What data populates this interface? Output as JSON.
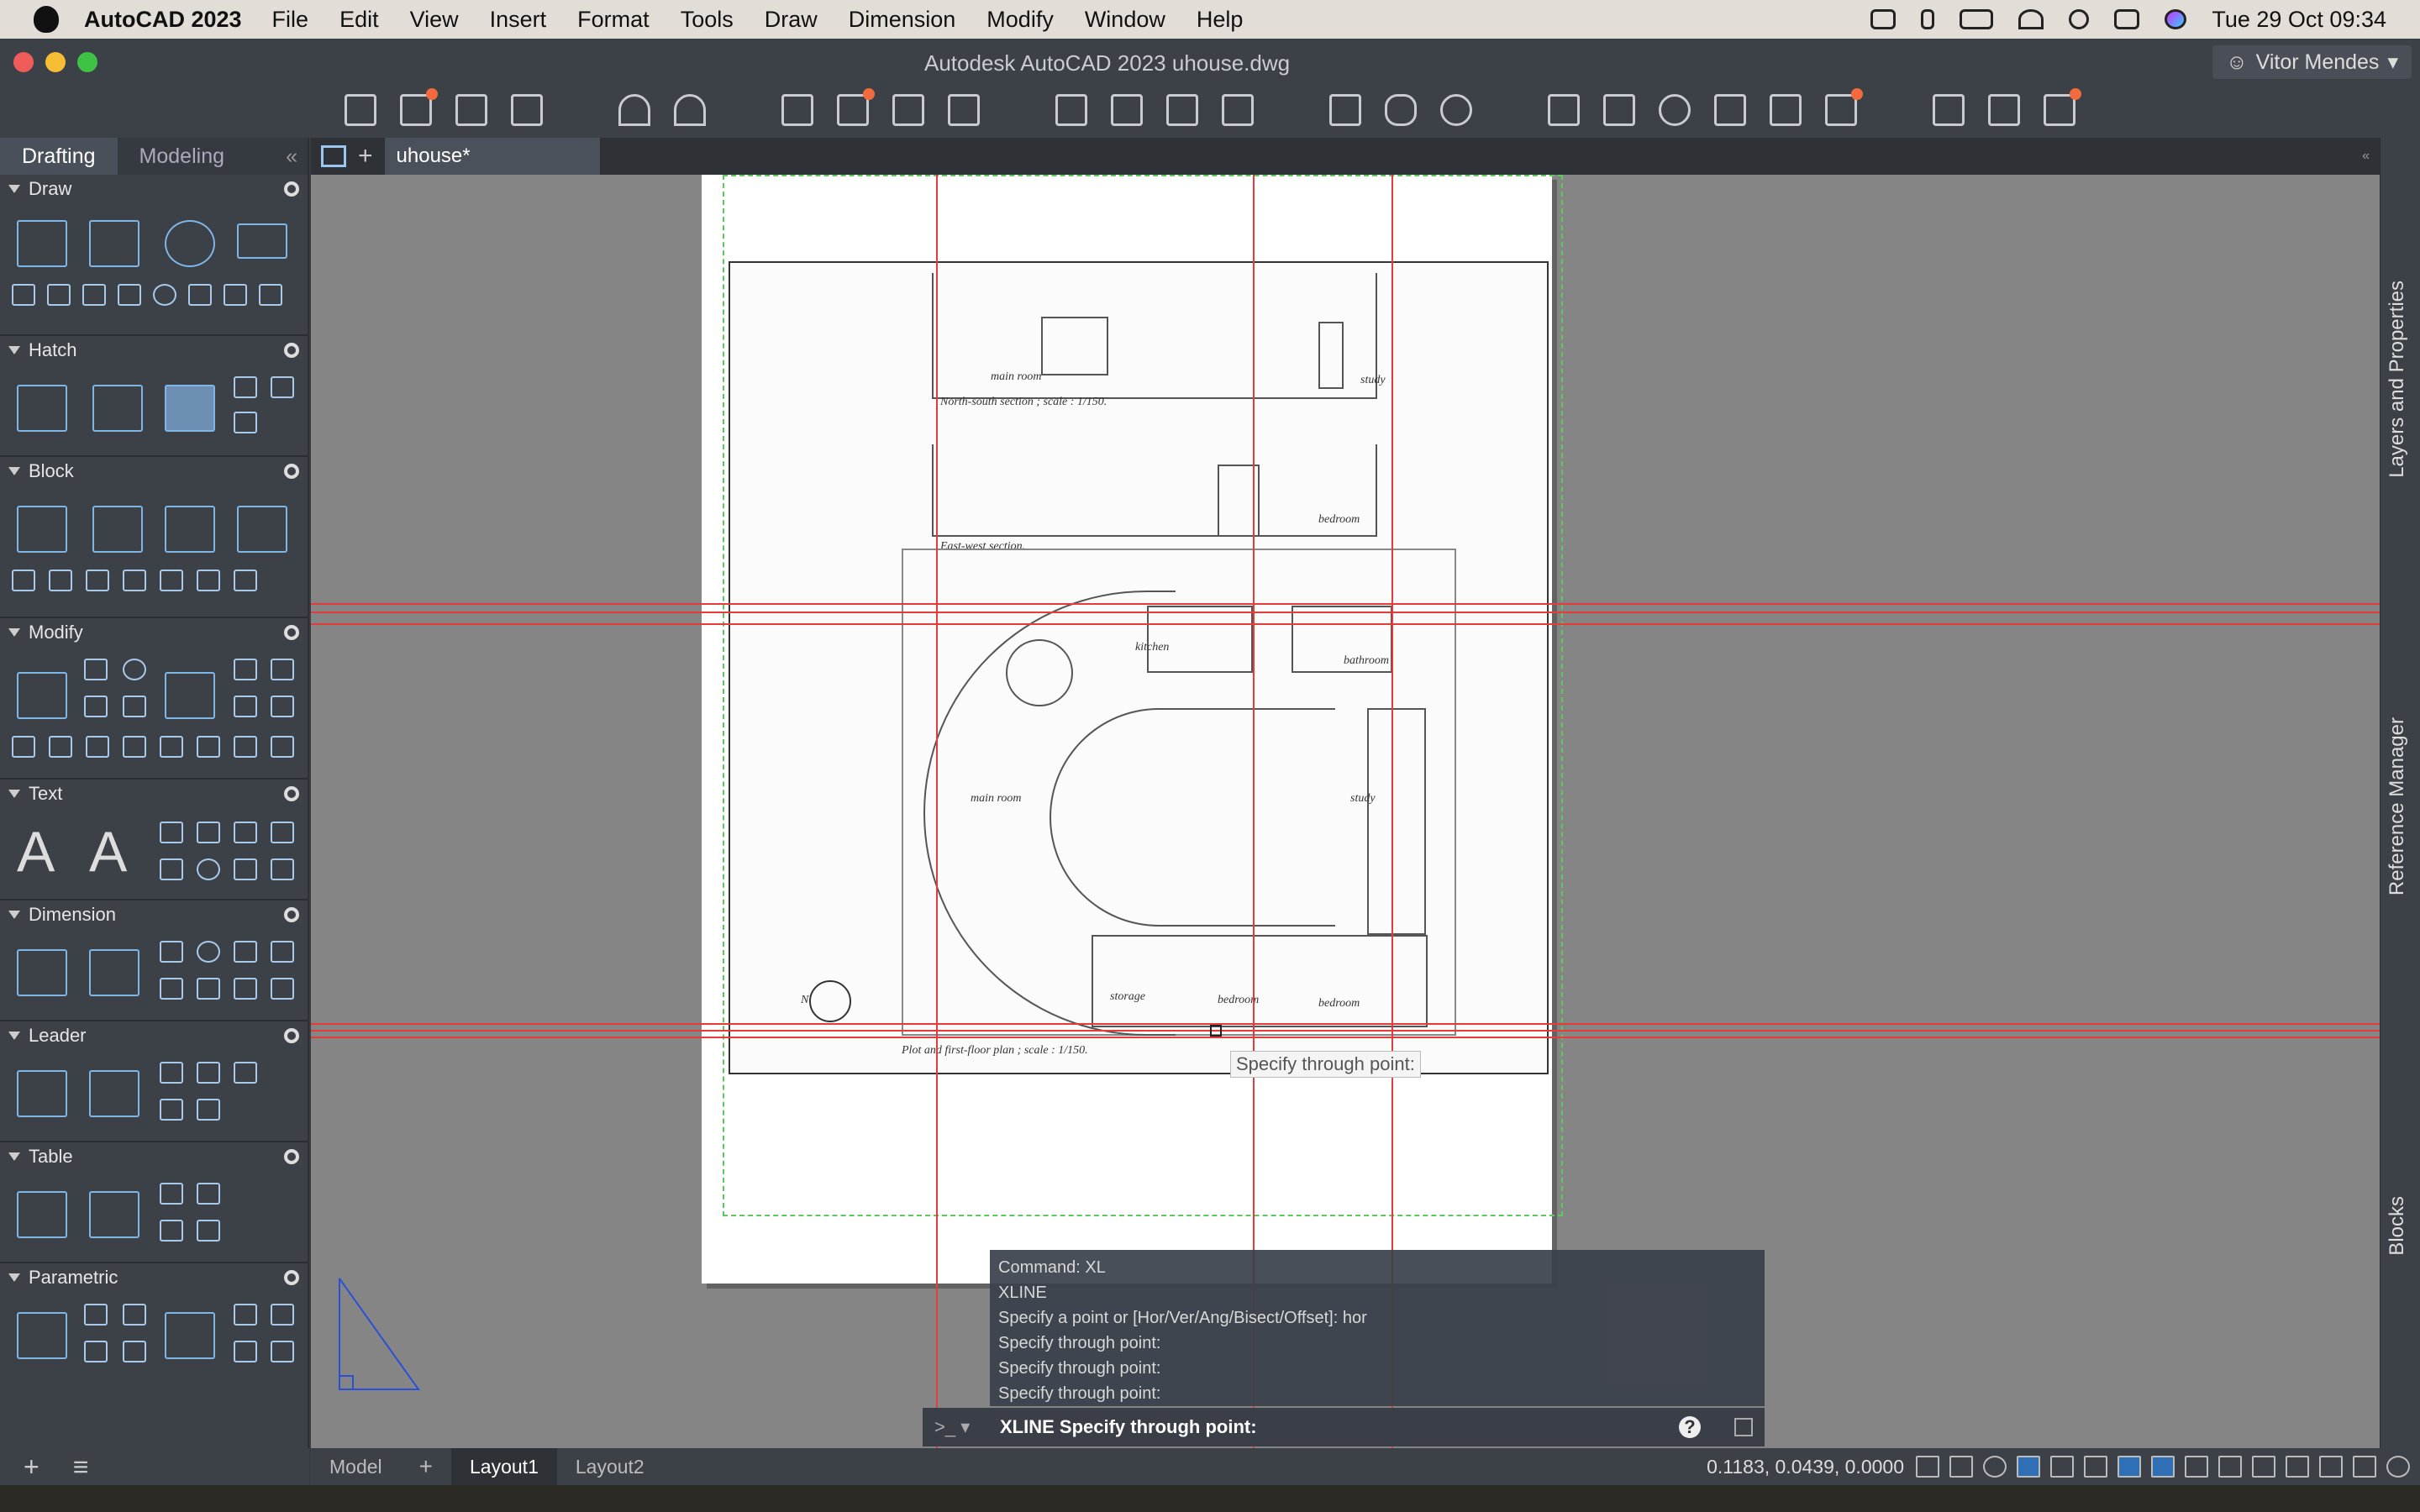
{
  "menubar": {
    "app_name": "AutoCAD 2023",
    "items": [
      "File",
      "Edit",
      "View",
      "Insert",
      "Format",
      "Tools",
      "Draw",
      "Dimension",
      "Modify",
      "Window",
      "Help"
    ],
    "datetime": "Tue 29 Oct  09:34"
  },
  "window": {
    "title": "Autodesk AutoCAD 2023    uhouse.dwg",
    "user": "Vitor Mendes"
  },
  "workspace_tabs": {
    "drafting": "Drafting",
    "modeling": "Modeling"
  },
  "palette_sections": {
    "draw": "Draw",
    "hatch": "Hatch",
    "block": "Block",
    "modify": "Modify",
    "text": "Text",
    "dimension": "Dimension",
    "leader": "Leader",
    "table": "Table",
    "parametric": "Parametric"
  },
  "document_tab": "uhouse*",
  "drawing_labels": {
    "ns_section": "North-south section ; scale :   1/150.",
    "ew_section": "East-west section.",
    "plan": "Plot and first-floor plan ; scale :   1/150.",
    "main_room_1": "main room",
    "study_1": "study",
    "bedroom_1": "bedroom",
    "kitchen": "kitchen",
    "bathroom": "bathroom",
    "main_room_2": "main room",
    "study_2": "study",
    "storage": "storage",
    "bedroom_2": "bedroom",
    "bedroom_3": "bedroom",
    "north": "N"
  },
  "tooltip": "Specify through point:",
  "command_history": [
    "Command: XL",
    "XLINE",
    "Specify a point or [Hor/Ver/Ang/Bisect/Offset]: hor",
    "Specify through point:",
    "Specify through point:",
    "Specify through point:"
  ],
  "command_prompt": {
    "symbol": ">_ ▾",
    "text": "XLINE Specify through point:",
    "help": "?"
  },
  "right_dock": {
    "layers": "Layers and Properties",
    "refs": "Reference Manager",
    "blocks": "Blocks"
  },
  "statusbar": {
    "model": "Model",
    "layout1": "Layout1",
    "layout2": "Layout2",
    "coords": "0.1183, 0.0439, 0.0000"
  },
  "colors": {
    "xline": "#e53b3b",
    "accent": "#7fb6e6",
    "badge": "#f26a3d"
  }
}
